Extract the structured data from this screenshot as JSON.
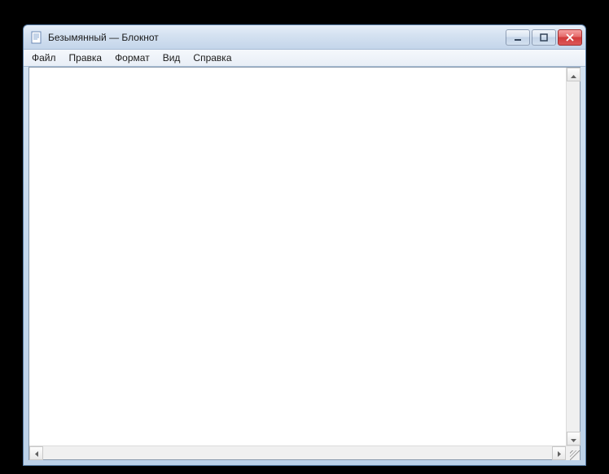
{
  "window": {
    "title": "Безымянный — Блокнот"
  },
  "menubar": {
    "items": [
      {
        "label": "Файл"
      },
      {
        "label": "Правка"
      },
      {
        "label": "Формат"
      },
      {
        "label": "Вид"
      },
      {
        "label": "Справка"
      }
    ]
  },
  "editor": {
    "content": ""
  }
}
